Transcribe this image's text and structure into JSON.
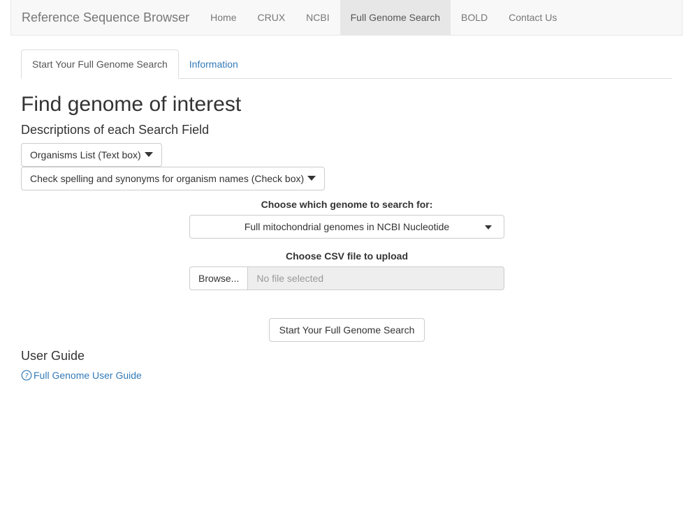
{
  "navbar": {
    "brand": "Reference Sequence Browser",
    "links": [
      {
        "label": "Home"
      },
      {
        "label": "CRUX"
      },
      {
        "label": "NCBI"
      },
      {
        "label": "Full Genome Search"
      },
      {
        "label": "BOLD"
      },
      {
        "label": "Contact Us"
      }
    ],
    "active": "Full Genome Search"
  },
  "tabs": [
    {
      "label": "Start Your Full Genome Search"
    },
    {
      "label": "Information"
    }
  ],
  "main": {
    "title": "Find genome of interest",
    "descriptions_heading": "Descriptions of each Search Field",
    "dropdowns": [
      {
        "label": "Organisms List (Text box)"
      },
      {
        "label": "Check spelling and synonyms for organism names (Check box)"
      }
    ],
    "genome_label": "Choose which genome to search for:",
    "genome_selected": "Full mitochondrial genomes in NCBI Nucleotide",
    "csv_label": "Choose CSV file to upload",
    "browse_label": "Browse...",
    "file_placeholder": "No file selected",
    "submit_label": "Start Your Full Genome Search"
  },
  "guide": {
    "heading": "User Guide",
    "link_label": "Full Genome User Guide",
    "link_icon": "question-circle-icon"
  },
  "colors": {
    "link": "#337ab7",
    "navbar_bg": "#f8f8f8",
    "active_nav_bg": "#e7e7e7"
  }
}
